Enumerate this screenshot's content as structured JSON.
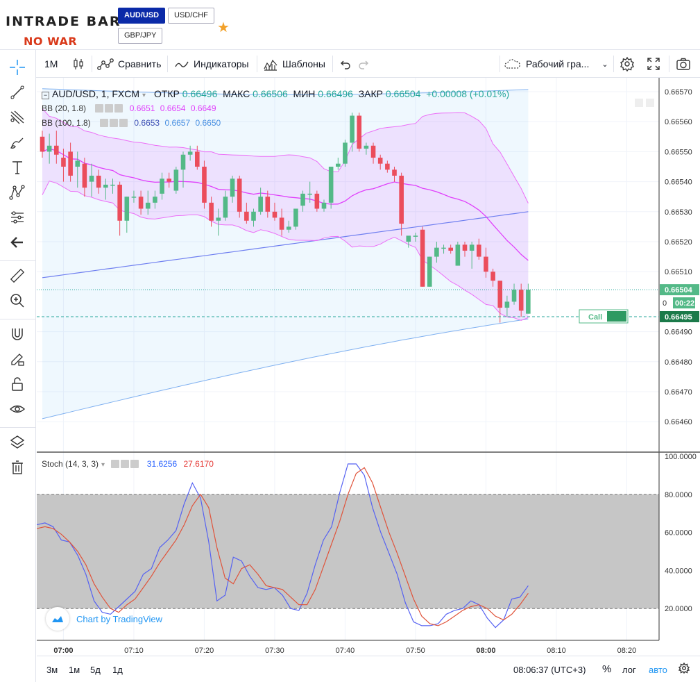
{
  "brand": {
    "logo": "INTRADE BAR",
    "slogan": "NO WAR"
  },
  "pairs": [
    {
      "label": "AUD/USD",
      "active": true
    },
    {
      "label": "USD/CHF",
      "active": false
    },
    {
      "label": "GBP/JPY",
      "active": false
    }
  ],
  "toolbar": {
    "interval": "1M",
    "compare": "Сравнить",
    "indicators": "Индикаторы",
    "templates": "Шаблоны",
    "layout": "Рабочий гра..."
  },
  "legend": {
    "symbol": "AUD/USD, 1, FXCM",
    "open_label": "ОТКР",
    "open": "0.66496",
    "high_label": "МАКС",
    "high": "0.66506",
    "low_label": "МИН",
    "low": "0.66496",
    "close_label": "ЗАКР",
    "close": "0.66504",
    "change": "+0.00008 (+0.01%)",
    "bb20": {
      "label": "BB (20, 1.8)",
      "v1": "0.6651",
      "v2": "0.6654",
      "v3": "0.6649"
    },
    "bb100": {
      "label": "BB (100, 1.8)",
      "v1": "0.6653",
      "v2": "0.6657",
      "v3": "0.6650"
    },
    "stoch": {
      "label": "Stoch (14, 3, 3)",
      "k": "31.6256",
      "d": "27.6170"
    }
  },
  "price_axis": [
    "0.66570",
    "0.66560",
    "0.66550",
    "0.66540",
    "0.66530",
    "0.66520",
    "0.66510",
    "0.66490",
    "0.66480",
    "0.66470",
    "0.66460"
  ],
  "stoch_axis": [
    "100.0000",
    "80.0000",
    "60.0000",
    "40.0000",
    "20.0000"
  ],
  "time_axis": [
    "07:00",
    "07:10",
    "07:20",
    "07:30",
    "07:40",
    "07:50",
    "08:00",
    "08:10",
    "08:20"
  ],
  "price_label": {
    "current": "0.66504",
    "countdown": "00:22",
    "countdown_prefix": "0",
    "call_price": "0.66495"
  },
  "call_label": "Call",
  "watermark": "Chart by TradingView",
  "bottom": {
    "ranges": [
      "3м",
      "1м",
      "5д",
      "1д"
    ],
    "clock": "08:06:37 (UTC+3)",
    "percent": "%",
    "log": "лог",
    "auto": "авто"
  },
  "colors": {
    "up": "#53b987",
    "down": "#eb4d5c",
    "brand_blue": "#0b2aa8",
    "accent": "#2196f3"
  },
  "chart_data": {
    "type": "candlestick",
    "x": [
      "06:57",
      "06:58",
      "06:59",
      "07:00",
      "07:01",
      "07:02",
      "07:03",
      "07:04",
      "07:05",
      "07:06",
      "07:07",
      "07:08",
      "07:09",
      "07:10",
      "07:11",
      "07:12",
      "07:13",
      "07:14",
      "07:15",
      "07:16",
      "07:17",
      "07:18",
      "07:19",
      "07:20",
      "07:21",
      "07:22",
      "07:23",
      "07:24",
      "07:25",
      "07:26",
      "07:27",
      "07:28",
      "07:29",
      "07:30",
      "07:31",
      "07:32",
      "07:33",
      "07:34",
      "07:35",
      "07:36",
      "07:37",
      "07:38",
      "07:39",
      "07:40",
      "07:41",
      "07:42",
      "07:43",
      "07:44",
      "07:45",
      "07:46",
      "07:47",
      "07:48",
      "07:49",
      "07:50",
      "07:51",
      "07:52",
      "07:53",
      "07:54",
      "07:55",
      "07:56",
      "07:57",
      "07:58",
      "07:59",
      "08:00",
      "08:01",
      "08:02",
      "08:03",
      "08:04",
      "08:05",
      "08:06"
    ],
    "ohlc": [
      [
        0.66555,
        0.66557,
        0.66548,
        0.6655
      ],
      [
        0.6655,
        0.66556,
        0.66546,
        0.66552
      ],
      [
        0.66552,
        0.66557,
        0.66546,
        0.66549
      ],
      [
        0.66548,
        0.66551,
        0.6654,
        0.66545
      ],
      [
        0.6655,
        0.66553,
        0.6654,
        0.66542
      ],
      [
        0.66545,
        0.6655,
        0.66538,
        0.66547
      ],
      [
        0.66546,
        0.66548,
        0.66535,
        0.66538
      ],
      [
        0.6654,
        0.66546,
        0.66535,
        0.66542
      ],
      [
        0.66542,
        0.66544,
        0.66536,
        0.66538
      ],
      [
        0.66538,
        0.66541,
        0.66534,
        0.66539
      ],
      [
        0.66539,
        0.66541,
        0.66536,
        0.66539
      ],
      [
        0.66539,
        0.6654,
        0.66522,
        0.66527
      ],
      [
        0.66527,
        0.66535,
        0.66523,
        0.66535
      ],
      [
        0.66535,
        0.66537,
        0.66533,
        0.66535
      ],
      [
        0.66535,
        0.66537,
        0.66529,
        0.66531
      ],
      [
        0.66531,
        0.66537,
        0.66529,
        0.66533
      ],
      [
        0.66533,
        0.66537,
        0.66531,
        0.66535
      ],
      [
        0.66536,
        0.66543,
        0.66534,
        0.66541
      ],
      [
        0.66541,
        0.66543,
        0.66538,
        0.6654
      ],
      [
        0.66537,
        0.66545,
        0.66536,
        0.66544
      ],
      [
        0.66544,
        0.6655,
        0.66538,
        0.66549
      ],
      [
        0.66549,
        0.66552,
        0.66547,
        0.6655
      ],
      [
        0.6655,
        0.66552,
        0.66544,
        0.66545
      ],
      [
        0.66545,
        0.66547,
        0.66531,
        0.66533
      ],
      [
        0.66533,
        0.66535,
        0.66525,
        0.66527
      ],
      [
        0.66527,
        0.66531,
        0.66522,
        0.66528
      ],
      [
        0.66528,
        0.66537,
        0.66527,
        0.66535
      ],
      [
        0.66535,
        0.66542,
        0.66533,
        0.66541
      ],
      [
        0.66541,
        0.66542,
        0.66528,
        0.6653
      ],
      [
        0.6653,
        0.66533,
        0.66526,
        0.66527
      ],
      [
        0.66527,
        0.66531,
        0.66525,
        0.6653
      ],
      [
        0.6653,
        0.66538,
        0.66529,
        0.66535
      ],
      [
        0.66535,
        0.66537,
        0.66528,
        0.6653
      ],
      [
        0.6653,
        0.66533,
        0.66527,
        0.66528
      ],
      [
        0.66528,
        0.66531,
        0.66522,
        0.66524
      ],
      [
        0.66524,
        0.66527,
        0.66523,
        0.66525
      ],
      [
        0.66525,
        0.66531,
        0.66524,
        0.66531
      ],
      [
        0.66532,
        0.66537,
        0.6653,
        0.66536
      ],
      [
        0.66536,
        0.6654,
        0.66533,
        0.66536
      ],
      [
        0.66536,
        0.66537,
        0.6653,
        0.66531
      ],
      [
        0.66531,
        0.66534,
        0.6653,
        0.66533
      ],
      [
        0.66533,
        0.66545,
        0.66531,
        0.66545
      ],
      [
        0.66545,
        0.66548,
        0.66544,
        0.66546
      ],
      [
        0.66546,
        0.66554,
        0.66545,
        0.66553
      ],
      [
        0.66553,
        0.66563,
        0.6655,
        0.66562
      ],
      [
        0.66562,
        0.66563,
        0.6655,
        0.66551
      ],
      [
        0.66551,
        0.66553,
        0.66549,
        0.66552
      ],
      [
        0.66552,
        0.66553,
        0.66546,
        0.66548
      ],
      [
        0.66548,
        0.66549,
        0.66544,
        0.66546
      ],
      [
        0.66546,
        0.66547,
        0.66543,
        0.66544
      ],
      [
        0.66544,
        0.66545,
        0.6654,
        0.66542
      ],
      [
        0.66542,
        0.66543,
        0.66522,
        0.66526
      ],
      [
        0.6652,
        0.66521,
        0.66518,
        0.66522
      ],
      [
        0.66522,
        0.66523,
        0.6652,
        0.66522
      ],
      [
        0.66524,
        0.66525,
        0.66505,
        0.66505
      ],
      [
        0.66505,
        0.66515,
        0.66505,
        0.66515
      ],
      [
        0.66515,
        0.6652,
        0.66513,
        0.66518
      ],
      [
        0.66518,
        0.66519,
        0.66516,
        0.66518
      ],
      [
        0.66518,
        0.66519,
        0.66516,
        0.66517
      ],
      [
        0.66512,
        0.6652,
        0.66512,
        0.66519
      ],
      [
        0.66519,
        0.6652,
        0.66515,
        0.66517
      ],
      [
        0.66517,
        0.6652,
        0.66511,
        0.66519
      ],
      [
        0.66519,
        0.66521,
        0.66514,
        0.66515
      ],
      [
        0.66515,
        0.66518,
        0.66508,
        0.6651
      ],
      [
        0.6651,
        0.66511,
        0.66505,
        0.66507
      ],
      [
        0.66507,
        0.66507,
        0.66493,
        0.66498
      ],
      [
        0.66498,
        0.66502,
        0.66495,
        0.665
      ],
      [
        0.665,
        0.66506,
        0.66499,
        0.66504
      ],
      [
        0.66504,
        0.66506,
        0.66495,
        0.66497
      ],
      [
        0.66496,
        0.66506,
        0.66496,
        0.66504
      ]
    ],
    "ylim": [
      0.66455,
      0.66575
    ],
    "stoch_k": [
      64,
      65,
      63,
      56,
      55,
      48,
      38,
      24,
      18,
      17,
      21,
      25,
      29,
      38,
      41,
      52,
      56,
      61,
      75,
      86,
      78,
      55,
      24,
      27,
      47,
      45,
      37,
      31,
      30,
      31,
      27,
      20,
      19,
      28,
      43,
      56,
      63,
      81,
      96,
      96,
      90,
      73,
      60,
      49,
      38,
      23,
      13,
      11,
      11,
      12,
      17,
      19,
      20,
      24,
      22,
      15,
      10,
      14,
      25,
      26,
      32
    ],
    "stoch_d": [
      62,
      63,
      62,
      59,
      55,
      50,
      43,
      33,
      26,
      20,
      18,
      22,
      25,
      31,
      37,
      44,
      50,
      56,
      64,
      74,
      80,
      73,
      52,
      36,
      33,
      41,
      43,
      38,
      32,
      31,
      30,
      26,
      22,
      22,
      30,
      42,
      54,
      66,
      80,
      91,
      94,
      86,
      73,
      60,
      49,
      37,
      25,
      16,
      12,
      11,
      13,
      16,
      19,
      21,
      22,
      20,
      16,
      14,
      17,
      22,
      28
    ],
    "stoch_ylim": [
      0,
      100
    ]
  }
}
